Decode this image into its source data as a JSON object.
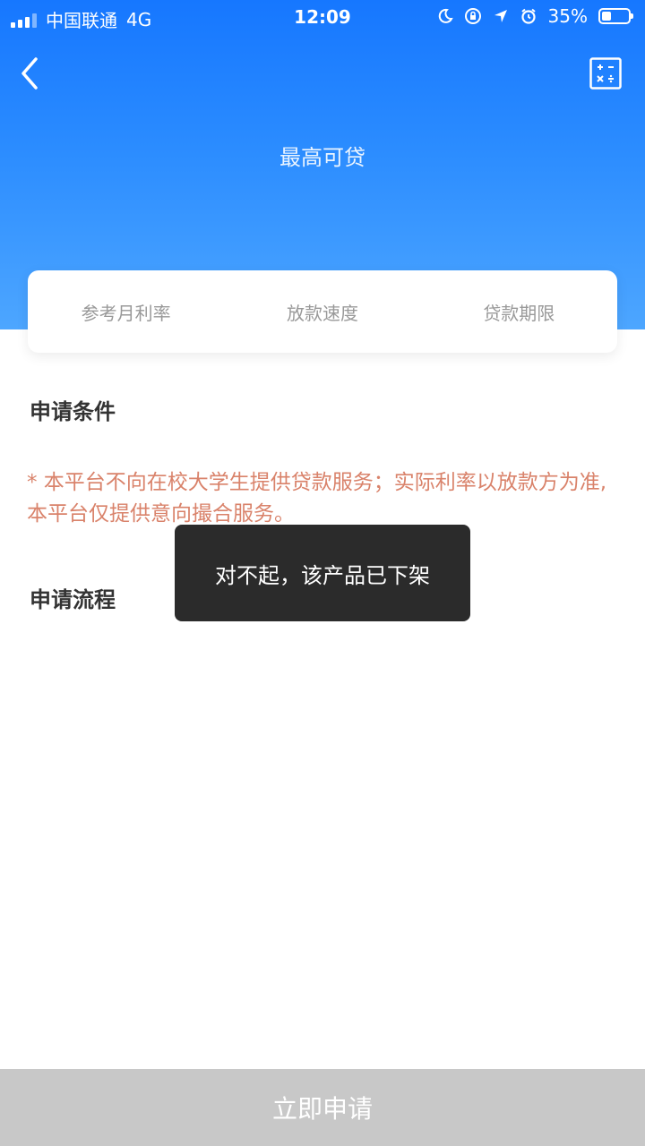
{
  "status_bar": {
    "carrier": "中国联通",
    "network": "4G",
    "time": "12:09",
    "battery": "35%",
    "battery_level": 0.35
  },
  "header": {
    "title": "最高可贷"
  },
  "info_card": {
    "items": [
      {
        "label": "参考月利率"
      },
      {
        "label": "放款速度"
      },
      {
        "label": "贷款期限"
      }
    ]
  },
  "conditions": {
    "title": "申请条件",
    "notice": "* 本平台不向在校大学生提供贷款服务；实际利率以放款方为准,本平台仅提供意向撮合服务。"
  },
  "process": {
    "title": "申请流程"
  },
  "toast": {
    "message": "对不起，该产品已下架"
  },
  "footer": {
    "apply_label": "立即申请"
  },
  "colors": {
    "primary": "#1677ff",
    "notice": "#d9826a",
    "disabled_button": "#c8c8c8"
  }
}
